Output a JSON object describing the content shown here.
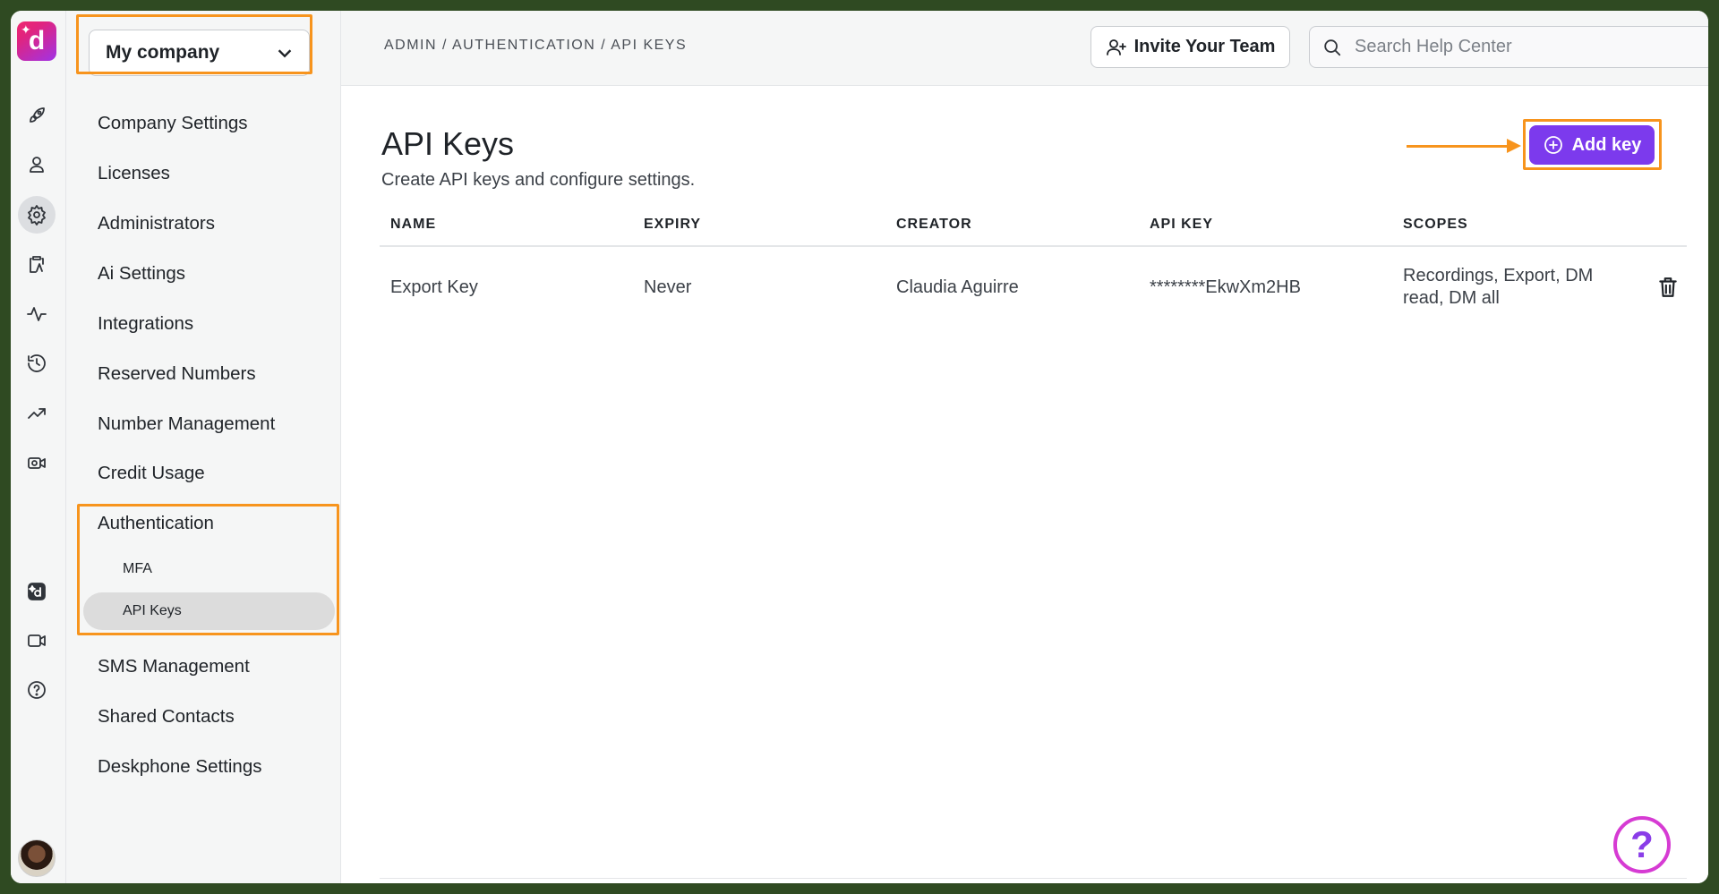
{
  "rail": {
    "logo_letter": "d",
    "items": [
      "rocket-icon",
      "person-icon",
      "gear-icon",
      "clipboard-icon",
      "activity-icon",
      "history-icon",
      "trend-icon",
      "camera-icon"
    ],
    "bottom_items": [
      "dialpad-ai-icon",
      "video-icon",
      "help-circle-icon"
    ]
  },
  "sidebar": {
    "company": "My company",
    "items": [
      {
        "label": "Company Settings"
      },
      {
        "label": "Licenses"
      },
      {
        "label": "Administrators"
      },
      {
        "label": "Ai Settings"
      },
      {
        "label": "Integrations"
      },
      {
        "label": "Reserved Numbers"
      },
      {
        "label": "Number Management"
      },
      {
        "label": "Credit Usage"
      },
      {
        "label": "Authentication"
      },
      {
        "label": "SMS Management"
      },
      {
        "label": "Shared Contacts"
      },
      {
        "label": "Deskphone Settings"
      }
    ],
    "sub_items": [
      {
        "label": "MFA"
      },
      {
        "label": "API Keys"
      }
    ]
  },
  "topbar": {
    "breadcrumb": "ADMIN / AUTHENTICATION / API KEYS",
    "invite_label": "Invite Your Team",
    "search_placeholder": "Search Help Center"
  },
  "main": {
    "title": "API Keys",
    "subtitle": "Create API keys and configure settings.",
    "add_key_label": "Add key",
    "columns": [
      "NAME",
      "EXPIRY",
      "CREATOR",
      "API KEY",
      "SCOPES"
    ],
    "rows": [
      {
        "name": "Export Key",
        "expiry": "Never",
        "creator": "Claudia Aguirre",
        "api_key": "********EkwXm2HB",
        "scopes_line1": "Recordings, Export, DM",
        "scopes_line2": "read, DM all"
      }
    ],
    "help_symbol": "?"
  },
  "colors": {
    "accent": "#7c3aed",
    "highlight": "#f7941d",
    "help_ring": "#d63bd3"
  }
}
